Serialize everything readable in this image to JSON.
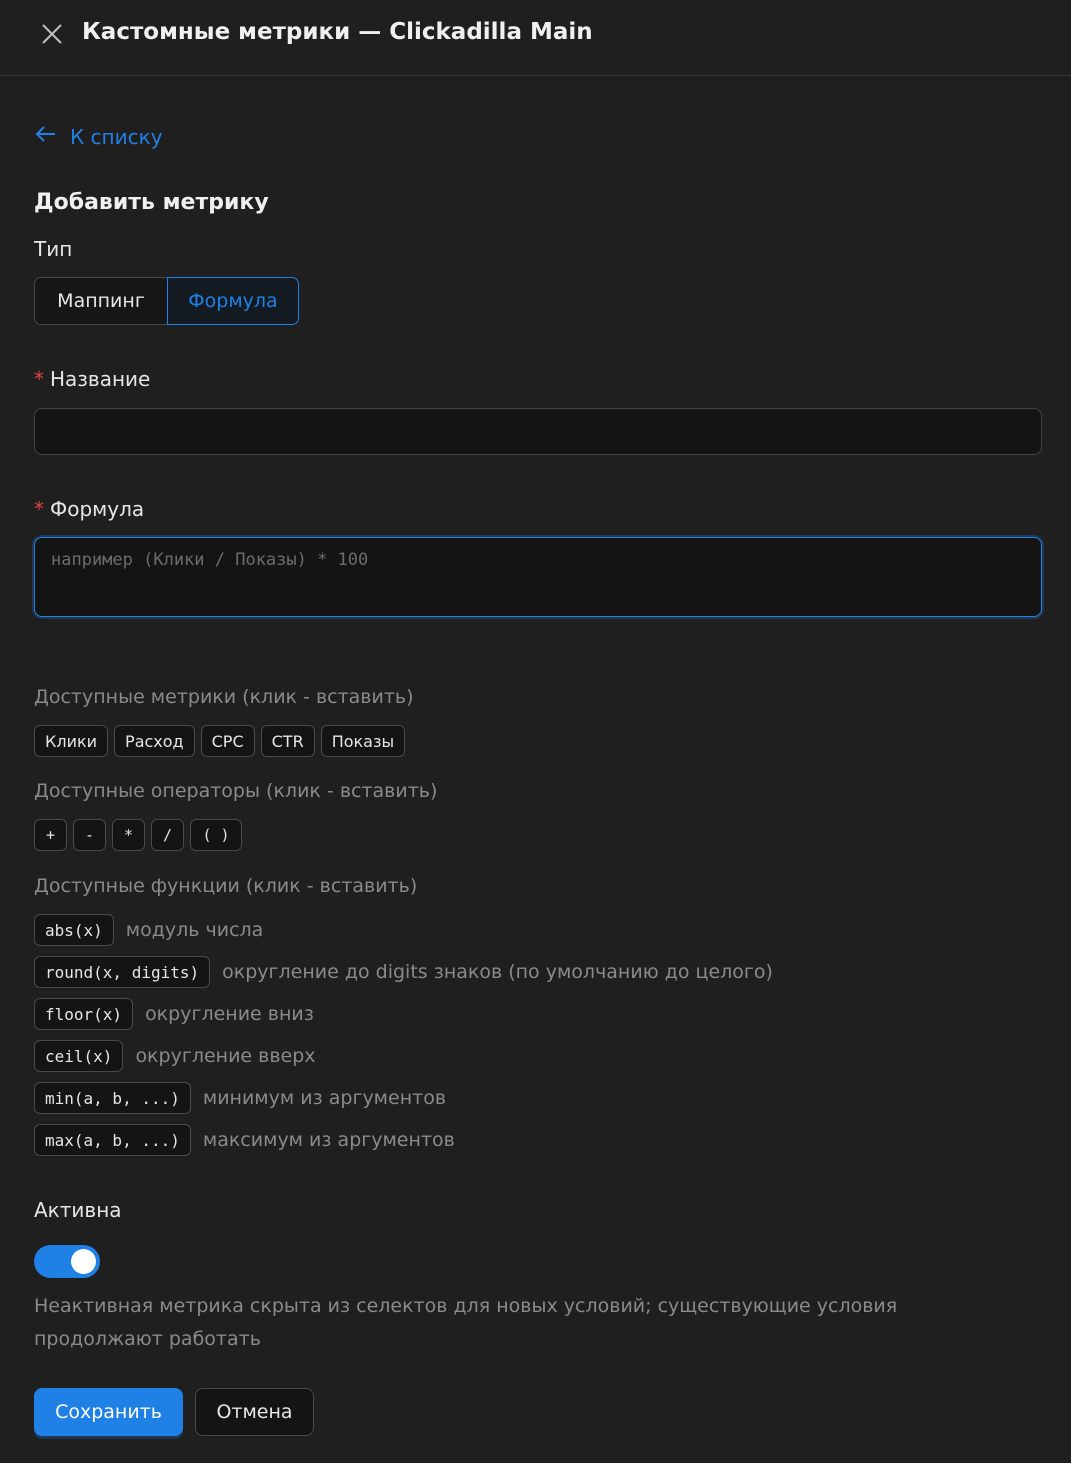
{
  "header": {
    "title": "Кастомные метрики — Clickadilla Main"
  },
  "back_link": "К списку",
  "section_title": "Добавить метрику",
  "type": {
    "label": "Тип",
    "options": [
      "Маппинг",
      "Формула"
    ],
    "selected": "Формула"
  },
  "name_field": {
    "label": "Название",
    "required_mark": "*",
    "value": ""
  },
  "formula_field": {
    "label": "Формула",
    "required_mark": "*",
    "placeholder": "например (Клики / Показы) * 100",
    "value": ""
  },
  "metrics": {
    "label": "Доступные метрики (клик - вставить)",
    "items": [
      "Клики",
      "Расход",
      "CPC",
      "CTR",
      "Показы"
    ]
  },
  "operators": {
    "label": "Доступные операторы (клик - вставить)",
    "items": [
      "+",
      "-",
      "*",
      "/",
      "( )"
    ]
  },
  "functions": {
    "label": "Доступные функции (клик - вставить)",
    "items": [
      {
        "name": "abs(x)",
        "desc": "модуль числа"
      },
      {
        "name": "round(x, digits)",
        "desc": "округление до digits знаков (по умолчанию до целого)"
      },
      {
        "name": "floor(x)",
        "desc": "округление вниз"
      },
      {
        "name": "ceil(x)",
        "desc": "округление вверх"
      },
      {
        "name": "min(a, b, ...)",
        "desc": "минимум из аргументов"
      },
      {
        "name": "max(a, b, ...)",
        "desc": "максимум из аргументов"
      }
    ]
  },
  "active": {
    "label": "Активна",
    "enabled": true,
    "hint": "Неактивная метрика скрыта из селектов для новых условий; существующие условия продолжают работать"
  },
  "buttons": {
    "save": "Сохранить",
    "cancel": "Отмена"
  },
  "colors": {
    "accent": "#1f80e6",
    "required": "#dc4446",
    "background": "#1f1f1f"
  }
}
